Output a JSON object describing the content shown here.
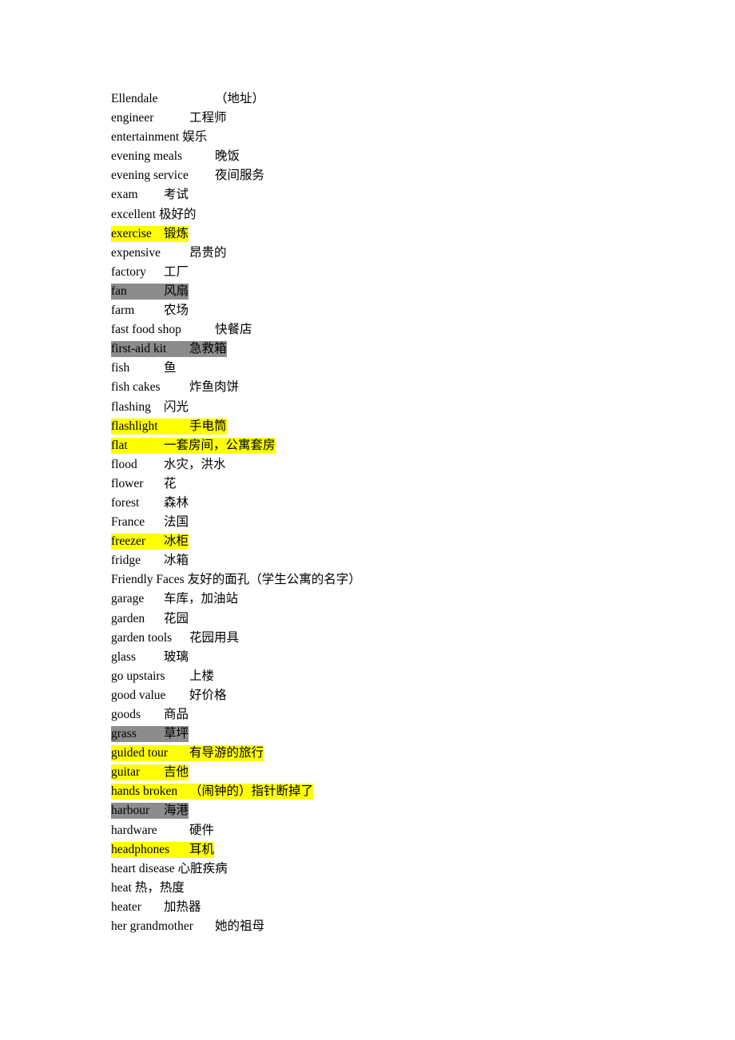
{
  "document": {
    "highlight_colors": {
      "yellow": "#ffff00",
      "gray": "#8c8c8c"
    },
    "entries": [
      {
        "term": "Ellendale",
        "definition": "（地址）",
        "highlight": "none",
        "def_col": 3
      },
      {
        "term": "engineer",
        "definition": "工程师",
        "highlight": "none",
        "def_col": 2
      },
      {
        "term": "entertainment",
        "definition": "娱乐",
        "highlight": "none",
        "def_col": 0
      },
      {
        "term": "evening meals",
        "definition": "晚饭",
        "highlight": "none",
        "def_col": 3
      },
      {
        "term": "evening service",
        "definition": "夜间服务",
        "highlight": "none",
        "def_col": 3
      },
      {
        "term": "exam",
        "definition": "考试",
        "highlight": "none",
        "def_col": 1
      },
      {
        "term": "excellent",
        "definition": "极好的",
        "highlight": "none",
        "def_col": 0
      },
      {
        "term": "exercise",
        "definition": "锻炼",
        "highlight": "yellow",
        "def_col": 1
      },
      {
        "term": "expensive",
        "definition": "昂贵的",
        "highlight": "none",
        "def_col": 2
      },
      {
        "term": "factory",
        "definition": "工厂",
        "highlight": "none",
        "def_col": 1
      },
      {
        "term": "fan",
        "definition": "风扇",
        "highlight": "gray",
        "def_col": 1
      },
      {
        "term": "farm",
        "definition": "农场",
        "highlight": "none",
        "def_col": 1
      },
      {
        "term": "fast food shop",
        "definition": "快餐店",
        "highlight": "none",
        "def_col": 3
      },
      {
        "term": "first-aid kit",
        "definition": "急救箱",
        "highlight": "gray",
        "def_col": 2
      },
      {
        "term": "fish",
        "definition": "鱼",
        "highlight": "none",
        "def_col": 1
      },
      {
        "term": "fish cakes",
        "definition": "炸鱼肉饼",
        "highlight": "none",
        "def_col": 2
      },
      {
        "term": "flashing",
        "definition": "闪光",
        "highlight": "none",
        "def_col": 1
      },
      {
        "term": "flashlight",
        "definition": "手电筒",
        "highlight": "yellow",
        "def_col": 2
      },
      {
        "term": "flat",
        "definition": "一套房间，公寓套房",
        "highlight": "yellow",
        "def_col": 1
      },
      {
        "term": "flood",
        "definition": "水灾，洪水",
        "highlight": "none",
        "def_col": 1
      },
      {
        "term": "flower",
        "definition": "花",
        "highlight": "none",
        "def_col": 1
      },
      {
        "term": "forest",
        "definition": "森林",
        "highlight": "none",
        "def_col": 1
      },
      {
        "term": "France",
        "definition": "法国",
        "highlight": "none",
        "def_col": 1
      },
      {
        "term": "freezer",
        "definition": "冰柜",
        "highlight": "yellow",
        "def_col": 1
      },
      {
        "term": "fridge",
        "definition": "冰箱",
        "highlight": "none",
        "def_col": 1
      },
      {
        "term": "Friendly Faces",
        "definition": "友好的面孔（学生公寓的名字）",
        "highlight": "none",
        "def_col": 0
      },
      {
        "term": "garage",
        "definition": "车库，加油站",
        "highlight": "none",
        "def_col": 1
      },
      {
        "term": "garden",
        "definition": "花园",
        "highlight": "none",
        "def_col": 1
      },
      {
        "term": "garden tools",
        "definition": "花园用具",
        "highlight": "none",
        "def_col": 2
      },
      {
        "term": "glass",
        "definition": "玻璃",
        "highlight": "none",
        "def_col": 1
      },
      {
        "term": "go upstairs",
        "definition": "上楼",
        "highlight": "none",
        "def_col": 2
      },
      {
        "term": "good value",
        "definition": "好价格",
        "highlight": "none",
        "def_col": 2
      },
      {
        "term": "goods",
        "definition": "商品",
        "highlight": "none",
        "def_col": 1
      },
      {
        "term": "grass",
        "definition": "草坪",
        "highlight": "gray",
        "def_col": 1
      },
      {
        "term": "guided tour",
        "definition": "有导游的旅行",
        "highlight": "yellow",
        "def_col": 2
      },
      {
        "term": "guitar",
        "definition": "吉他",
        "highlight": "yellow",
        "def_col": 1
      },
      {
        "term": "hands broken",
        "definition": "（闹钟的）指针断掉了",
        "highlight": "yellow",
        "def_col": 2
      },
      {
        "term": "harbour",
        "definition": "海港",
        "highlight": "gray",
        "def_col": 1
      },
      {
        "term": "hardware",
        "definition": "硬件",
        "highlight": "none",
        "def_col": 2
      },
      {
        "term": "headphones",
        "definition": "耳机",
        "highlight": "yellow",
        "def_col": 2
      },
      {
        "term": "heart disease",
        "definition": "心脏疾病",
        "highlight": "none",
        "def_col": 0
      },
      {
        "term": "heat",
        "definition": "热，热度",
        "highlight": "none",
        "def_col": 0
      },
      {
        "term": "heater",
        "definition": "加热器",
        "highlight": "none",
        "def_col": 1
      },
      {
        "term": "her grandmother",
        "definition": "她的祖母",
        "highlight": "none",
        "def_col": 3
      }
    ]
  }
}
